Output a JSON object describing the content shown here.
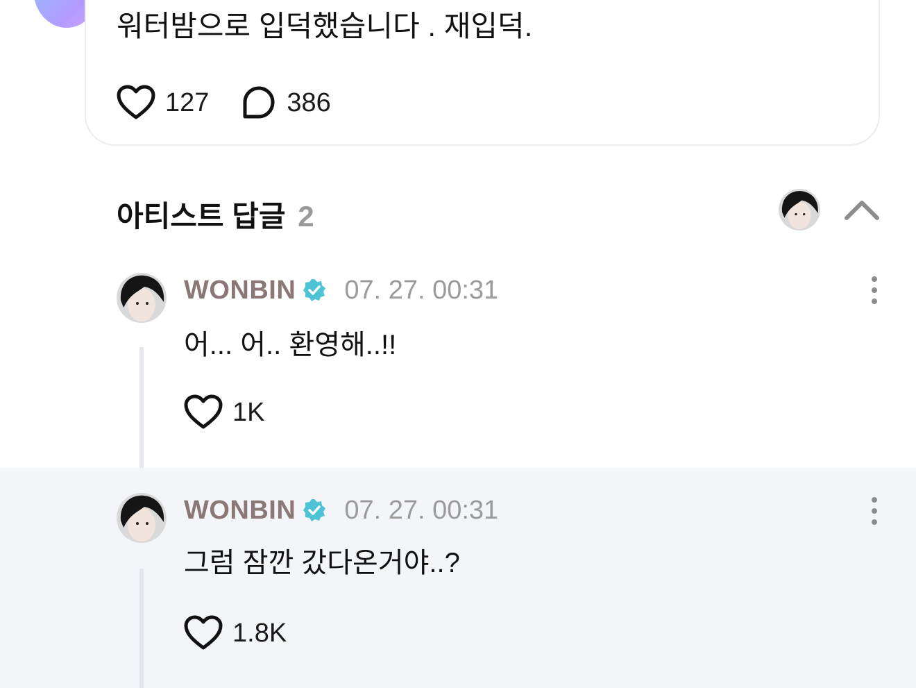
{
  "post": {
    "text": "워터밤으로 입덕했습니다 . 재입덕.",
    "like_count": "127",
    "comment_count": "386"
  },
  "section": {
    "title": "아티스트 답글",
    "count": "2"
  },
  "replies": [
    {
      "author": "WONBIN",
      "timestamp": "07. 27. 00:31",
      "text": "어... 어.. 환영해..!!",
      "likes": "1K"
    },
    {
      "author": "WONBIN",
      "timestamp": "07. 27. 00:31",
      "text": "그럼 잠깐 갔다온거야..?",
      "likes": "1.8K"
    }
  ],
  "colors": {
    "author": "#8a7776",
    "verified_badge": "#4fc3d6",
    "highlight_bg": "#f4f5f8",
    "muted": "#9b9b9b"
  },
  "icons": [
    "heart-icon",
    "comment-icon",
    "verified-badge-icon",
    "chevron-up-icon",
    "more-vertical-icon"
  ]
}
